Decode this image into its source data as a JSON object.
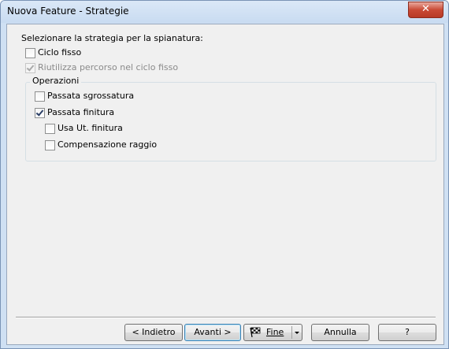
{
  "window": {
    "title": "Nuova Feature - Strategie",
    "close_glyph": "✕"
  },
  "main": {
    "prompt": "Selezionare la strategia per la spianatura:",
    "ciclo_fisso": {
      "label": "Ciclo fisso",
      "checked": false,
      "enabled": true
    },
    "riutilizza": {
      "label": "Riutilizza percorso nel ciclo fisso",
      "checked": true,
      "enabled": false
    },
    "operazioni": {
      "label": "Operazioni",
      "passata_sgrossatura": {
        "label": "Passata sgrossatura",
        "checked": false
      },
      "passata_finitura": {
        "label": "Passata finitura",
        "checked": true
      },
      "usa_ut_finitura": {
        "label": "Usa Ut. finitura",
        "checked": false
      },
      "compensazione_raggio": {
        "label": "Compensazione raggio",
        "checked": false
      }
    }
  },
  "footer": {
    "back": "< Indietro",
    "next": "Avanti >",
    "finish": "Fine",
    "cancel": "Annulla",
    "help": "?"
  }
}
